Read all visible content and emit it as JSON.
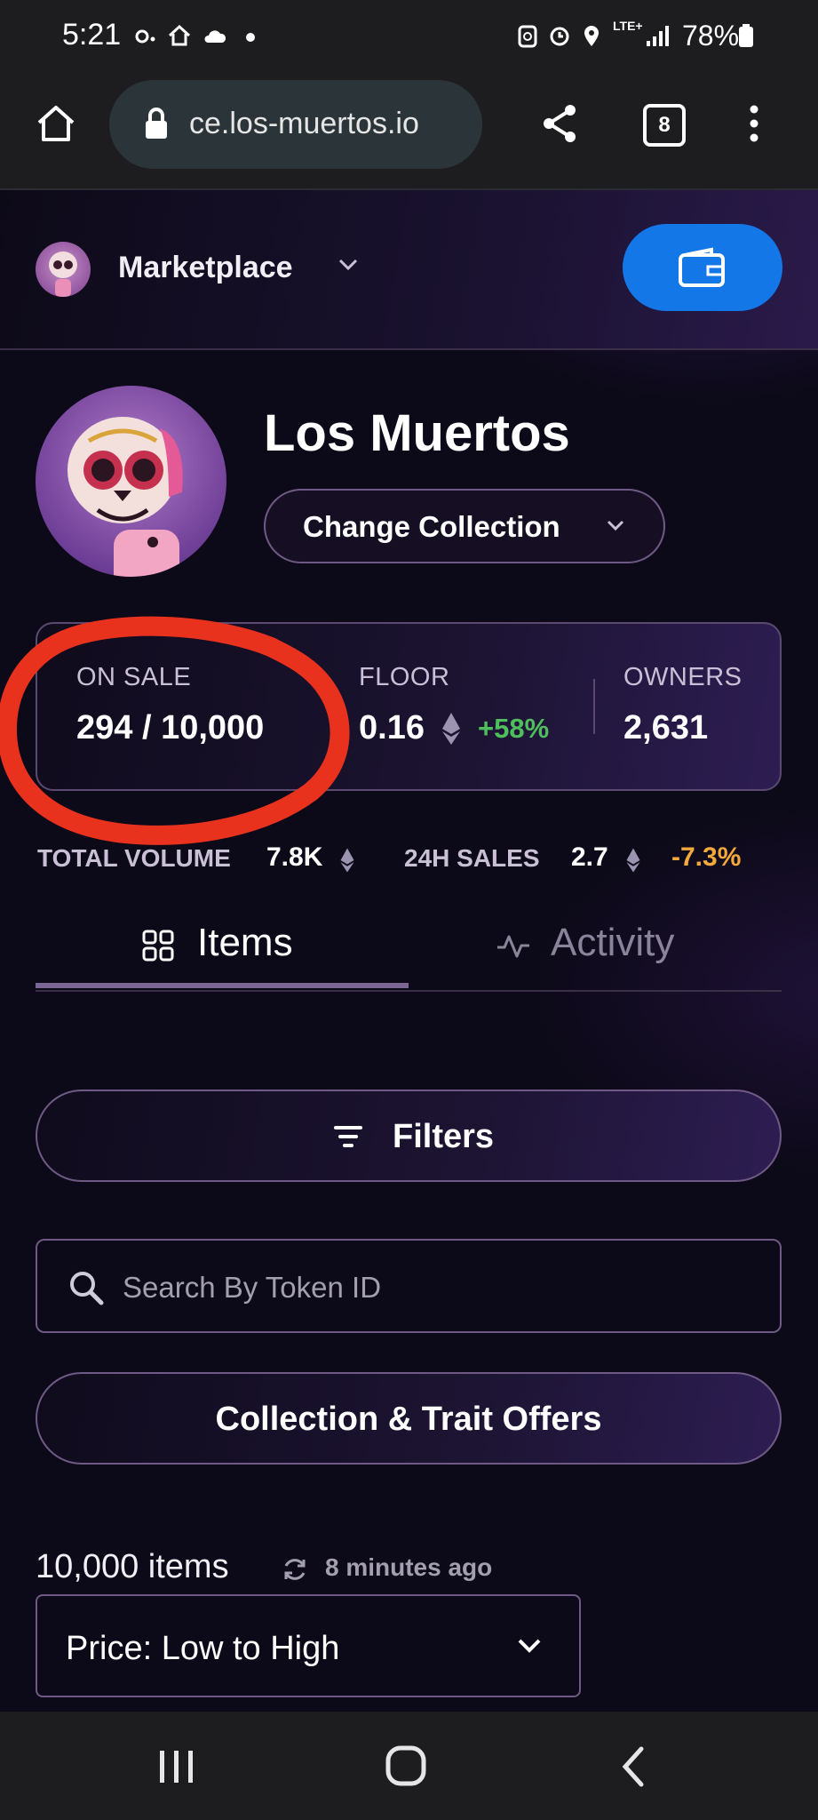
{
  "status_bar": {
    "time": "5:21",
    "network": "LTE+",
    "battery": "78%",
    "icons": [
      "carrier-icon",
      "home-app-icon",
      "cloud-app-icon",
      "dot-icon",
      "recycle-icon",
      "alarm-icon",
      "location-icon",
      "signal-icon",
      "battery-icon"
    ]
  },
  "browser": {
    "url": "ce.los-muertos.io",
    "tab_count": "8",
    "icons": [
      "home-icon",
      "lock-icon",
      "share-icon",
      "tabs-icon",
      "more-menu-icon"
    ]
  },
  "header": {
    "nav_title": "Marketplace",
    "wallet_icon": "wallet-icon"
  },
  "collection": {
    "name": "Los Muertos",
    "change_label": "Change Collection"
  },
  "stats": {
    "on_sale_label": "ON SALE",
    "on_sale_value": "294 / 10,000",
    "floor_label": "FLOOR",
    "floor_value": "0.16",
    "floor_change": "+58%",
    "owners_label": "OWNERS",
    "owners_value": "2,631"
  },
  "secondary_stats": {
    "volume_label": "TOTAL VOLUME",
    "volume_value": "7.8K",
    "sales_label": "24H SALES",
    "sales_value": "2.7",
    "sales_change": "-7.3%"
  },
  "tabs": [
    {
      "label": "Items",
      "active": true
    },
    {
      "label": "Activity",
      "active": false
    }
  ],
  "actions": {
    "filters_label": "Filters",
    "search_placeholder": "Search By Token ID",
    "offers_label": "Collection & Trait Offers"
  },
  "list": {
    "items_count": "10,000 items",
    "refreshed": "8 minutes ago",
    "sort_value": "Price: Low to High"
  },
  "colors": {
    "accent_blue": "#1477e8",
    "positive": "#4fbf5d",
    "negative": "#f3a93c",
    "annotation": "#e8321e"
  }
}
